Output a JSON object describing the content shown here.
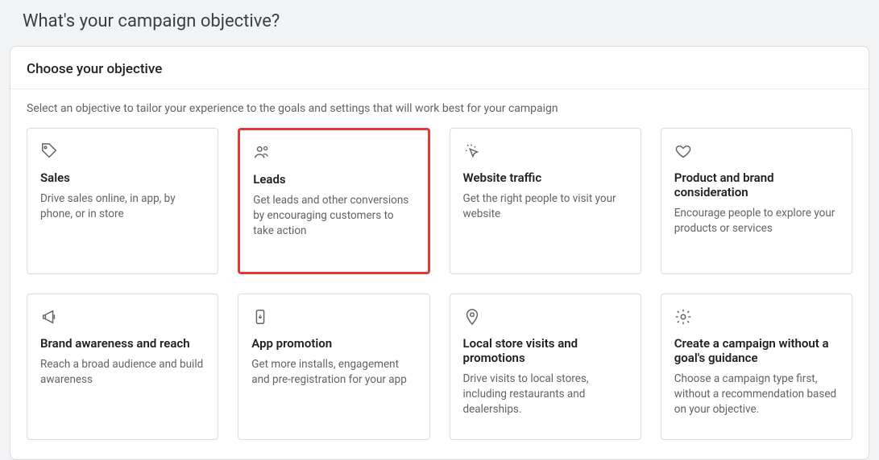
{
  "header": {
    "title": "What's your campaign objective?"
  },
  "panel": {
    "title": "Choose your objective",
    "description": "Select an objective to tailor your experience to the goals and settings that will work best for your campaign"
  },
  "cards": [
    {
      "icon": "tag",
      "title": "Sales",
      "desc": "Drive sales online, in app, by phone, or in store",
      "highlight": false
    },
    {
      "icon": "leads",
      "title": "Leads",
      "desc": "Get leads and other conversions by encouraging customers to take action",
      "highlight": true
    },
    {
      "icon": "click",
      "title": "Website traffic",
      "desc": "Get the right people to visit your website",
      "highlight": false
    },
    {
      "icon": "heart",
      "title": "Product and brand consideration",
      "desc": "Encourage people to explore your products or services",
      "highlight": false
    },
    {
      "icon": "megaphone",
      "title": "Brand awareness and reach",
      "desc": "Reach a broad audience and build awareness",
      "highlight": false
    },
    {
      "icon": "app",
      "title": "App promotion",
      "desc": "Get more installs, engagement and pre-registration for your app",
      "highlight": false
    },
    {
      "icon": "pin",
      "title": "Local store visits and promotions",
      "desc": "Drive visits to local stores, including restaurants and dealerships.",
      "highlight": false
    },
    {
      "icon": "gear",
      "title": "Create a campaign without a goal's guidance",
      "desc": "Choose a campaign type first, without a recommendation based on your objective.",
      "highlight": false
    }
  ]
}
